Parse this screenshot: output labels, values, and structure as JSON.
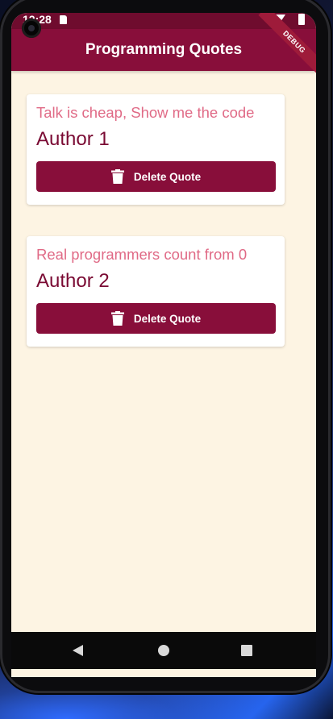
{
  "status_bar": {
    "time": "12:28"
  },
  "app_bar": {
    "title": "Programming Quotes",
    "debug_label": "DEBUG"
  },
  "quotes": [
    {
      "text": "Talk is cheap, Show me the code",
      "author": "Author 1",
      "button_label": "Delete Quote"
    },
    {
      "text": "Real programmers count from 0",
      "author": "Author 2",
      "button_label": "Delete Quote"
    }
  ],
  "nav": {
    "icons": [
      "back-icon",
      "home-icon",
      "recents-icon"
    ]
  },
  "colors": {
    "app_bar": "#880e3a",
    "status_bar": "#6f0c2e",
    "background": "#fdf4e3",
    "quote_text": "#e06a86",
    "author_text": "#7a0a33",
    "button": "#880e3a"
  }
}
